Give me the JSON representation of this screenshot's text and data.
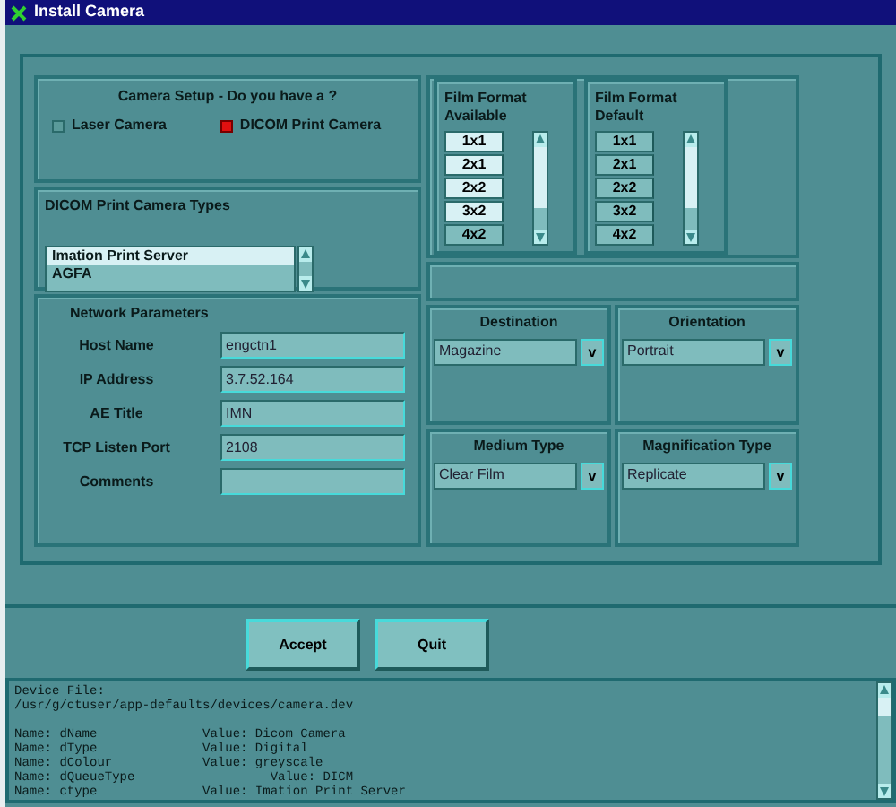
{
  "window": {
    "title": "Install Camera"
  },
  "camera_setup": {
    "title": "Camera Setup - Do you have a ?",
    "options": [
      {
        "label": "Laser Camera",
        "checked": false
      },
      {
        "label": "DICOM Print Camera",
        "checked": true
      }
    ]
  },
  "camera_types": {
    "title": "DICOM Print Camera Types",
    "items": [
      {
        "label": "Imation Print Server",
        "selected": true
      },
      {
        "label": "AGFA",
        "selected": false
      }
    ]
  },
  "network": {
    "title": "Network Parameters",
    "fields": [
      {
        "label": "Host Name",
        "value": "engctn1"
      },
      {
        "label": "IP Address",
        "value": "3.7.52.164"
      },
      {
        "label": "AE Title",
        "value": "IMN"
      },
      {
        "label": "TCP Listen Port",
        "value": "2108"
      },
      {
        "label": "Comments"
      }
    ]
  },
  "film_formats": [
    {
      "title": "Film Format Available",
      "items": [
        {
          "label": "1x1",
          "selected": true
        },
        {
          "label": "2x1",
          "selected": true
        },
        {
          "label": "2x2",
          "selected": true
        },
        {
          "label": "3x2",
          "selected": true
        },
        {
          "label": "4x2",
          "selected": false
        }
      ]
    },
    {
      "title": "Film Format Default",
      "items": [
        {
          "label": "1x1",
          "selected": false
        },
        {
          "label": "2x1",
          "selected": false
        },
        {
          "label": "2x2",
          "selected": false
        },
        {
          "label": "3x2",
          "selected": false
        },
        {
          "label": "4x2",
          "selected": false
        }
      ]
    }
  ],
  "options": [
    {
      "label": "Destination",
      "value": "Magazine",
      "arrow": "v"
    },
    {
      "label": "Orientation",
      "value": "Portrait",
      "arrow": "v"
    },
    {
      "label": "Medium Type",
      "value": "Clear Film",
      "arrow": "v"
    },
    {
      "label": "Magnification Type",
      "value": "Replicate",
      "arrow": "v"
    }
  ],
  "buttons": [
    {
      "label": "Accept"
    },
    {
      "label": "Quit"
    }
  ],
  "log": {
    "lines": [
      "Device File:",
      "/usr/g/ctuser/app-defaults/devices/camera.dev",
      "Name: dName              Value: Dicom Camera",
      "Name: dType              Value: Digital",
      "Name: dColour            Value: greyscale",
      "Name: dQueueType                  Value: DICM",
      "Name: ctype              Value: Imation Print Server"
    ]
  }
}
